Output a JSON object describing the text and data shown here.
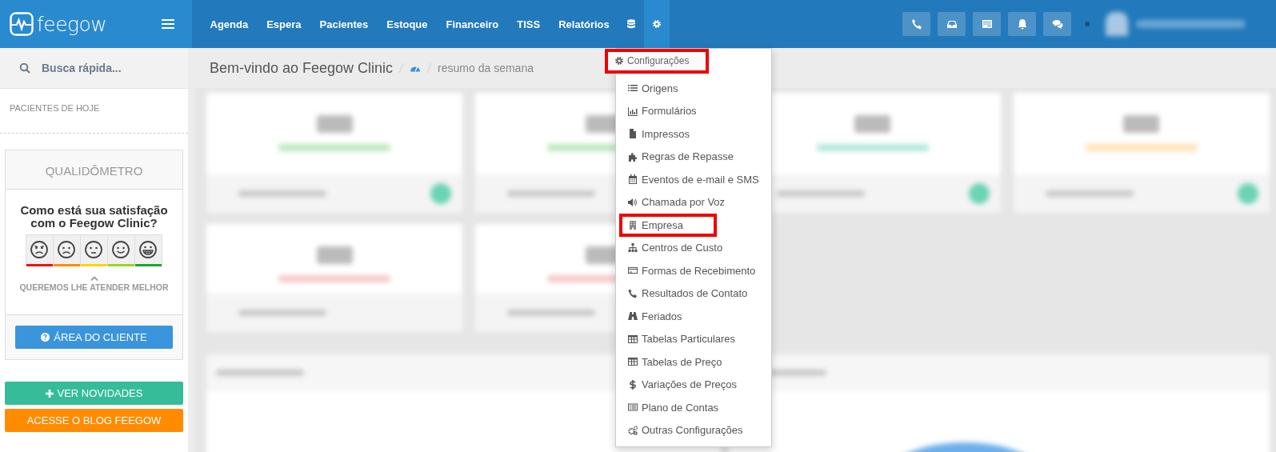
{
  "brand": {
    "name": "feegow"
  },
  "nav": [
    {
      "kind": "text",
      "label": "Agenda",
      "selected": false
    },
    {
      "kind": "text",
      "label": "Espera",
      "selected": false
    },
    {
      "kind": "text",
      "label": "Pacientes",
      "selected": false
    },
    {
      "kind": "text",
      "label": "Estoque",
      "selected": false
    },
    {
      "kind": "text",
      "label": "Financeiro",
      "selected": false
    },
    {
      "kind": "text",
      "label": "TISS",
      "selected": false
    },
    {
      "kind": "text",
      "label": "Relatórios",
      "selected": false
    },
    {
      "kind": "database",
      "selected": false
    },
    {
      "kind": "gear",
      "selected": true
    }
  ],
  "toolbar": [
    {
      "kind": "phone"
    },
    {
      "kind": "inbox"
    },
    {
      "kind": "card"
    },
    {
      "kind": "bell"
    },
    {
      "kind": "chat"
    }
  ],
  "search": {
    "placeholder": "Busca rápida..."
  },
  "sidebar": {
    "section_title": "PACIENTES DE HOJE",
    "survey": {
      "title": "QUALIDÔMETRO",
      "question": "Como está sua satisfação com o Feegow Clinic?",
      "faces": [
        {
          "kind": "angry",
          "color": "#ee1111"
        },
        {
          "kind": "sad",
          "color": "#ff8c00"
        },
        {
          "kind": "neutral",
          "color": "#ffd400"
        },
        {
          "kind": "happy",
          "color": "#99d522"
        },
        {
          "kind": "grin",
          "color": "#11aa33"
        }
      ],
      "caption": "QUEREMOS LHE ATENDER MELHOR",
      "button": "ÁREA DO CLIENTE"
    },
    "buttons": [
      {
        "kind": "news",
        "label": "VER NOVIDADES"
      },
      {
        "kind": "blog",
        "label": "ACESSE O BLOG FEEGOW"
      }
    ]
  },
  "breadcrumb": {
    "title": "Bem-vindo ao Feegow Clinic",
    "current": "resumo da semana"
  },
  "dropdown": {
    "header": {
      "label": "Configurações",
      "highlighted": true
    },
    "items": [
      {
        "label": "Origens",
        "highlighted": false
      },
      {
        "label": "Formulários",
        "highlighted": false
      },
      {
        "label": "Impressos",
        "highlighted": false
      },
      {
        "label": "Regras de Repasse",
        "highlighted": false
      },
      {
        "label": "Eventos de e-mail e SMS",
        "highlighted": false
      },
      {
        "label": "Chamada por Voz",
        "highlighted": false
      },
      {
        "label": "Empresa",
        "highlighted": true
      },
      {
        "label": "Centros de Custo",
        "highlighted": false
      },
      {
        "label": "Formas de Recebimento",
        "highlighted": false
      },
      {
        "label": "Resultados de Contato",
        "highlighted": false
      },
      {
        "label": "Feriados",
        "highlighted": false
      },
      {
        "label": "Tabelas Particulares",
        "highlighted": false
      },
      {
        "label": "Tabelas de Preço",
        "highlighted": false
      },
      {
        "label": "Variações de Preços",
        "highlighted": false
      },
      {
        "label": "Plano de Contas",
        "highlighted": false
      },
      {
        "label": "Outras Configurações",
        "highlighted": false
      }
    ]
  }
}
